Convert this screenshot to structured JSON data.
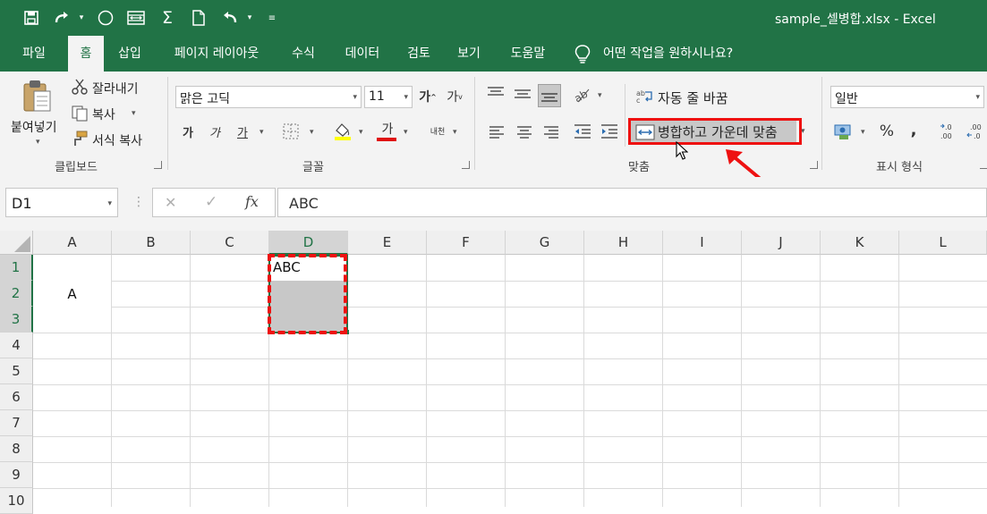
{
  "titlebar": {
    "title": "sample_셀병합.xlsx  -  Excel",
    "qa_icons": [
      "save-icon",
      "redo-icon",
      "dropdown-icon",
      "circle-icon",
      "merge-icon",
      "autosum-icon",
      "new-file-icon",
      "undo-icon",
      "undo-dropdown-icon",
      "customize-icon"
    ]
  },
  "menu": {
    "tabs": [
      "파일",
      "홈",
      "삽입",
      "페이지 레이아웃",
      "수식",
      "데이터",
      "검토",
      "보기",
      "도움말"
    ],
    "active": "홈",
    "tell_me": "어떤 작업을 원하시나요?"
  },
  "ribbon": {
    "clipboard": {
      "paste": "붙여넣기",
      "cut": "잘라내기",
      "copy": "복사",
      "format_painter": "서식 복사",
      "label": "클립보드"
    },
    "font": {
      "name": "맑은 고딕",
      "size": "11",
      "grow": "가",
      "shrink": "가",
      "bold": "가",
      "italic": "가",
      "underline": "가",
      "font_color": "가",
      "phonetic": "내천",
      "label": "글꼴",
      "fill_color": "#ffff00",
      "text_color": "#ff0000"
    },
    "alignment": {
      "wrap_text": "자동 줄 바꿈",
      "merge_center": "병합하고 가운데 맞춤",
      "label": "맞춤"
    },
    "number": {
      "format": "일반",
      "percent": "%",
      "comma": ",",
      "inc_decimal": "+.0 .00",
      "dec_decimal": ".00 +.0",
      "label": "표시 형식"
    }
  },
  "formula_bar": {
    "name_box": "D1",
    "cancel": "✕",
    "enter": "✓",
    "fx": "fx",
    "content": "ABC"
  },
  "sheet": {
    "columns": [
      "A",
      "B",
      "C",
      "D",
      "E",
      "F",
      "G",
      "H",
      "I",
      "J",
      "K",
      "L"
    ],
    "rows": [
      "1",
      "2",
      "3",
      "4",
      "5",
      "6",
      "7",
      "8",
      "9",
      "10"
    ],
    "selected_column": "D",
    "cells": {
      "A1_merged": "A",
      "D1": "ABC"
    }
  },
  "highlight_color": "#ff0000",
  "accent": "#217346"
}
